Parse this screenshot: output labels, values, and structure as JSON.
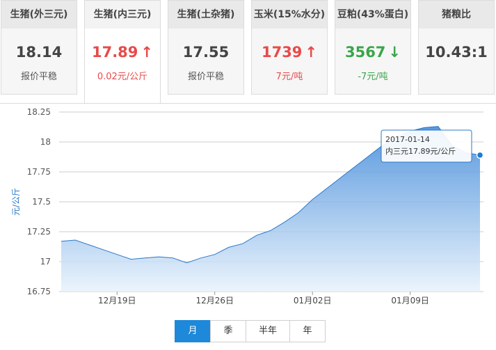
{
  "tabs": [
    {
      "title": "生猪(外三元)",
      "price": "18.14",
      "arrow": "",
      "trend": "neutral",
      "sub": "报价平稳"
    },
    {
      "title": "生猪(内三元)",
      "price": "17.89",
      "arrow": "↑",
      "trend": "up",
      "sub": "0.02元/公斤"
    },
    {
      "title": "生猪(土杂猪)",
      "price": "17.55",
      "arrow": "",
      "trend": "neutral",
      "sub": "报价平稳"
    },
    {
      "title": "玉米(15%水分)",
      "price": "1739",
      "arrow": "↑",
      "trend": "up",
      "sub": "7元/吨"
    },
    {
      "title": "豆粕(43%蛋白)",
      "price": "3567",
      "arrow": "↓",
      "trend": "down",
      "sub": "-7元/吨"
    },
    {
      "title": "猪粮比",
      "price": "10.43:1",
      "arrow": "",
      "trend": "neutral",
      "sub": ""
    }
  ],
  "period_buttons": [
    "月",
    "季",
    "半年",
    "年"
  ],
  "active_period": "月",
  "colors": {
    "up": "#e84a4a",
    "down": "#3aa54a",
    "accent": "#1e88d9",
    "area_top": "#3a86d8",
    "area_bottom": "#e8f2fc"
  },
  "chart_data": {
    "type": "area",
    "ylabel": "元/公斤",
    "ylim": [
      16.75,
      18.25
    ],
    "yticks": [
      "16.75",
      "17",
      "17.25",
      "17.5",
      "17.75",
      "18",
      "18.25"
    ],
    "xticks": [
      {
        "date": "2016-12-19",
        "label": "12月19日"
      },
      {
        "date": "2016-12-26",
        "label": "12月26日"
      },
      {
        "date": "2017-01-02",
        "label": "01月02日"
      },
      {
        "date": "2017-01-09",
        "label": "01月09日"
      }
    ],
    "x": [
      "2016-12-15",
      "2016-12-16",
      "2016-12-17",
      "2016-12-18",
      "2016-12-19",
      "2016-12-20",
      "2016-12-21",
      "2016-12-22",
      "2016-12-23",
      "2016-12-24",
      "2016-12-25",
      "2016-12-26",
      "2016-12-27",
      "2016-12-28",
      "2016-12-29",
      "2016-12-30",
      "2016-12-31",
      "2017-01-01",
      "2017-01-02",
      "2017-01-03",
      "2017-01-04",
      "2017-01-05",
      "2017-01-06",
      "2017-01-07",
      "2017-01-08",
      "2017-01-09",
      "2017-01-10",
      "2017-01-11",
      "2017-01-12",
      "2017-01-13",
      "2017-01-14"
    ],
    "values": [
      17.17,
      17.18,
      17.14,
      17.1,
      17.06,
      17.02,
      17.03,
      17.04,
      17.03,
      16.99,
      17.03,
      17.06,
      17.12,
      17.15,
      17.22,
      17.26,
      17.33,
      17.41,
      17.52,
      17.61,
      17.7,
      17.79,
      17.88,
      17.97,
      18.04,
      18.09,
      18.12,
      18.13,
      17.97,
      17.91,
      17.89
    ],
    "grid": true,
    "tooltip": {
      "date": "2017-01-14",
      "text": "内三元17.89元/公斤"
    }
  }
}
